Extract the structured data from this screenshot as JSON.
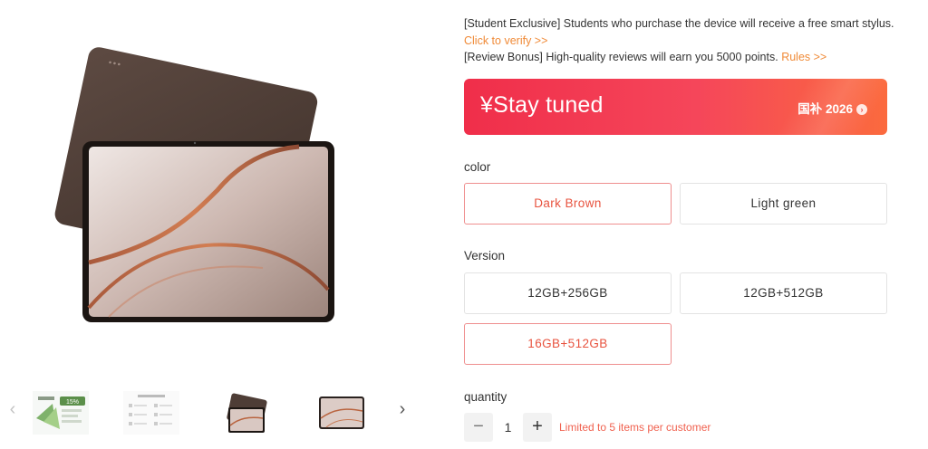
{
  "promotions": {
    "student": "[Student Exclusive] Students who purchase the device will receive a free smart stylus.",
    "verify_link": "Click to verify >>",
    "review": "[Review Bonus] High-quality reviews will earn you 5000 points.",
    "rules_link": "Rules >>"
  },
  "price_banner": {
    "price": "¥Stay tuned",
    "subsidy": "国补 2026",
    "subsidy_arrow": "›"
  },
  "color": {
    "label": "color",
    "options": [
      "Dark Brown",
      "Light green"
    ],
    "selected": "Dark Brown"
  },
  "version": {
    "label": "Version",
    "options": [
      "12GB+256GB",
      "12GB+512GB",
      "16GB+512GB"
    ],
    "selected": "16GB+512GB"
  },
  "quantity": {
    "label": "quantity",
    "value": "1",
    "minus": "−",
    "plus": "+",
    "limit": "Limited to 5 items per customer"
  },
  "gallery": {
    "prev_arrow": "‹",
    "next_arrow": "›",
    "selected_thumb": 3,
    "thumb_badge": "15%"
  },
  "colors": {
    "accent_orange": "#f08a37",
    "selected_red": "#e8533f",
    "banner_start": "#f02e4a",
    "banner_end": "#fb6a3e",
    "device_brown": "#4a3a34"
  }
}
